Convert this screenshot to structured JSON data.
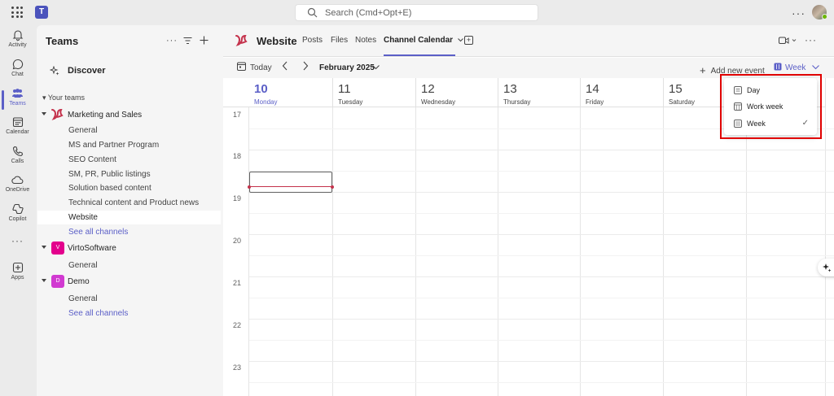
{
  "topbar": {
    "search_placeholder": "Search (Cmd+Opt+E)",
    "more": "···"
  },
  "rail": {
    "items": [
      {
        "label": "Activity",
        "icon": "bell-icon"
      },
      {
        "label": "Chat",
        "icon": "chat-icon"
      },
      {
        "label": "Teams",
        "icon": "teams-icon",
        "active": true
      },
      {
        "label": "Calendar",
        "icon": "calendar-icon"
      },
      {
        "label": "Calls",
        "icon": "phone-icon"
      },
      {
        "label": "OneDrive",
        "icon": "cloud-icon"
      },
      {
        "label": "Copilot",
        "icon": "copilot-icon"
      },
      {
        "label": "···",
        "icon": "more-icon"
      },
      {
        "label": "Apps",
        "icon": "apps-icon"
      }
    ]
  },
  "panel": {
    "title": "Teams",
    "discover": "Discover",
    "your_teams": "Your teams",
    "teams": [
      {
        "name": "Marketing and Sales",
        "avatar": "",
        "color": "#c4314b",
        "channels": [
          "General",
          "MS and Partner Program",
          "SEO Content",
          "SM, PR, Public listings",
          "Solution based content",
          "Technical content and Product news",
          "Website"
        ],
        "selected_channel": "Website",
        "see_all": "See all channels"
      },
      {
        "name": "VirtoSoftware",
        "avatar": "V",
        "color": "#e3008c",
        "channels": [
          "General"
        ]
      },
      {
        "name": "Demo",
        "avatar": "D",
        "color": "#d13ad1",
        "channels": [
          "General"
        ],
        "see_all": "See all channels"
      }
    ]
  },
  "channel_header": {
    "name": "Website",
    "tabs": [
      "Posts",
      "Files",
      "Notes",
      "Channel Calendar"
    ],
    "active_tab": "Channel Calendar",
    "add_tab": "+"
  },
  "toolbar": {
    "today": "Today",
    "month": "February 2025",
    "add_event": "Add new event",
    "view": "Week"
  },
  "calendar": {
    "days": [
      {
        "num": "10",
        "name": "Monday",
        "today": true
      },
      {
        "num": "11",
        "name": "Tuesday"
      },
      {
        "num": "12",
        "name": "Wednesday"
      },
      {
        "num": "13",
        "name": "Thursday"
      },
      {
        "num": "14",
        "name": "Friday"
      },
      {
        "num": "15",
        "name": "Saturday"
      }
    ],
    "hours": [
      "17",
      "18",
      "19",
      "20",
      "21",
      "22",
      "23"
    ]
  },
  "view_menu": {
    "items": [
      {
        "label": "Day",
        "icon": "day-view-icon"
      },
      {
        "label": "Work week",
        "icon": "work-week-icon"
      },
      {
        "label": "Week",
        "icon": "week-view-icon",
        "selected": true
      }
    ],
    "check": "✓"
  },
  "colors": {
    "accent": "#5b5fc7",
    "now_line": "#c4314b",
    "highlight": "#e00000"
  }
}
